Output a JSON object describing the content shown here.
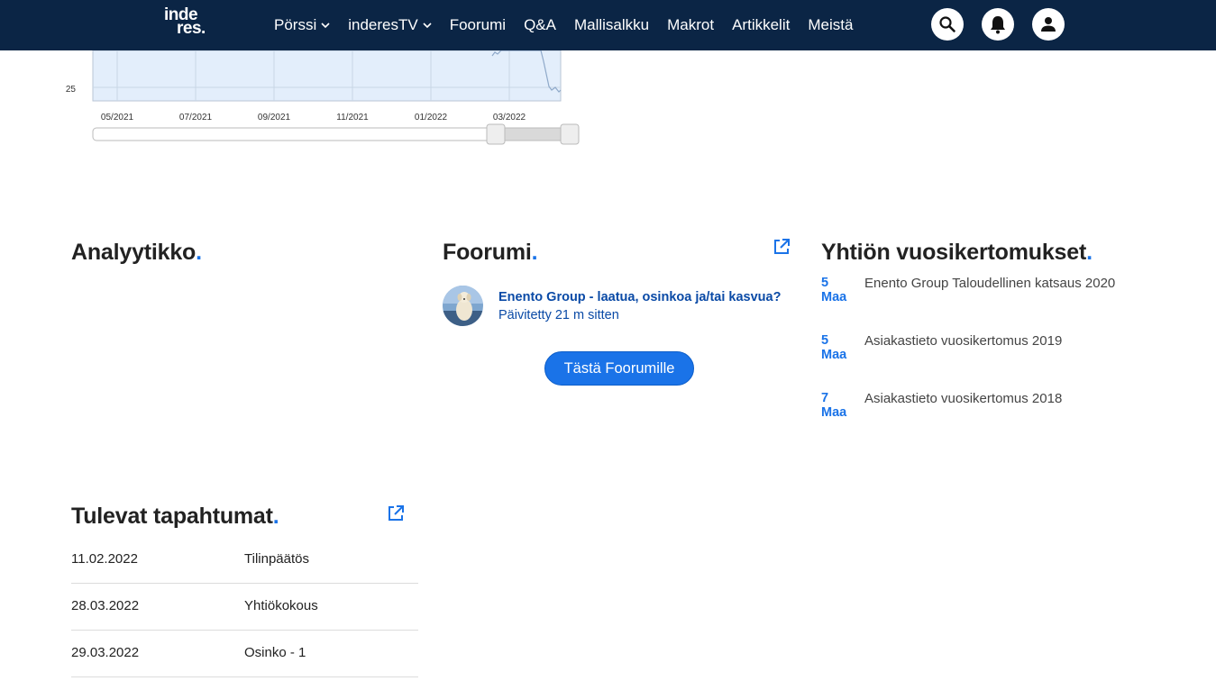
{
  "header": {
    "logo_line1": "inde",
    "logo_line2": "res.",
    "nav": [
      {
        "label": "Pörssi",
        "has_dropdown": true
      },
      {
        "label": "inderesTV",
        "has_dropdown": true
      },
      {
        "label": "Foorumi",
        "has_dropdown": false
      },
      {
        "label": "Q&A",
        "has_dropdown": false
      },
      {
        "label": "Mallisalkku",
        "has_dropdown": false
      },
      {
        "label": "Makrot",
        "has_dropdown": false
      },
      {
        "label": "Artikkelit",
        "has_dropdown": false
      },
      {
        "label": "Meistä",
        "has_dropdown": false
      }
    ],
    "icons": [
      "search-icon",
      "bell-icon",
      "user-icon"
    ],
    "bg_color": "#0b2545"
  },
  "chart_data": {
    "type": "area",
    "y_tick_labels": [
      "25"
    ],
    "x_tick_labels": [
      "05/2021",
      "07/2021",
      "09/2021",
      "11/2021",
      "01/2022",
      "03/2022"
    ],
    "navigator_selection": [
      0.845,
      1.0
    ],
    "fill_color": "#e3eefb",
    "line_color": "#8fa9c9"
  },
  "analyst": {
    "title": "Analyytikko",
    "dot": "."
  },
  "forum": {
    "title": "Foorumi",
    "dot": ".",
    "thread_title": "Enento Group - laatua, osinkoa ja/tai kasvua?",
    "updated": "Päivitetty 21 m sitten",
    "button_label": "Tästä Foorumille"
  },
  "reports": {
    "title": "Yhtiön vuosikertomukset",
    "dot": ".",
    "items": [
      {
        "day": "5",
        "month": "Maa",
        "title": "Enento Group Taloudellinen katsaus 2020"
      },
      {
        "day": "5",
        "month": "Maa",
        "title": "Asiakastieto vuosikertomus 2019"
      },
      {
        "day": "7",
        "month": "Maa",
        "title": "Asiakastieto vuosikertomus 2018"
      }
    ]
  },
  "events": {
    "title": "Tulevat tapahtumat",
    "dot": ".",
    "rows": [
      {
        "date": "11.02.2022",
        "name": "Tilinpäätös"
      },
      {
        "date": "28.03.2022",
        "name": "Yhtiökokous"
      },
      {
        "date": "29.03.2022",
        "name": "Osinko - 1"
      }
    ]
  },
  "colors": {
    "accent": "#1a73e8",
    "link": "#0a4aa6"
  }
}
